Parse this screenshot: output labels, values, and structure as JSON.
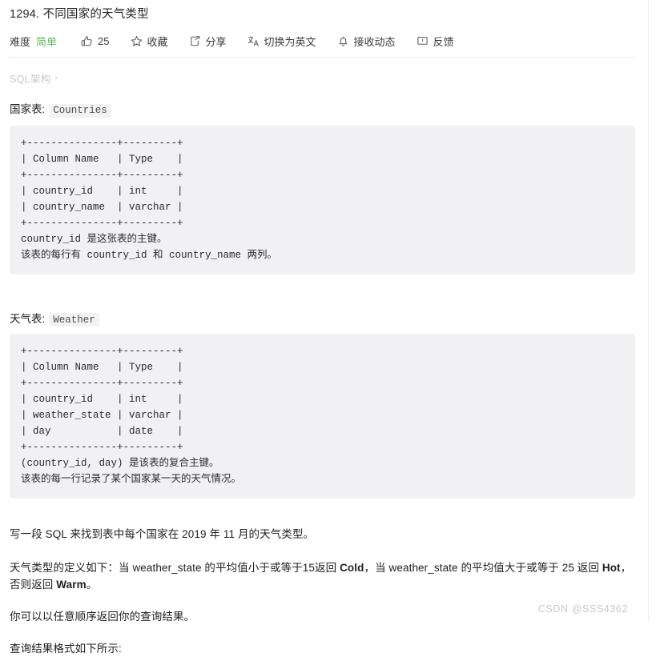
{
  "problem": {
    "title": "1294. 不同国家的天气类型"
  },
  "toolbar": {
    "difficulty_label": "难度",
    "difficulty_value": "简单",
    "like_count": "25",
    "favorite_label": "收藏",
    "share_label": "分享",
    "translate_label": "切换为英文",
    "subscribe_label": "接收动态",
    "feedback_label": "反馈",
    "icons": {
      "like": "thumbs-up-icon",
      "favorite": "star-icon",
      "share": "share-icon",
      "translate": "translate-icon",
      "subscribe": "bell-icon",
      "feedback": "feedback-icon"
    }
  },
  "schema_section": {
    "label": "SQL架构",
    "chevron": "›"
  },
  "tables": [
    {
      "caption": "国家表:",
      "name": "Countries",
      "code": "+---------------+---------+\n| Column Name   | Type    |\n+---------------+---------+\n| country_id    | int     |\n| country_name  | varchar |\n+---------------+---------+\ncountry_id 是这张表的主键。\n该表的每行有 country_id 和 country_name 两列。"
    },
    {
      "caption": "天气表:",
      "name": "Weather",
      "code": "+---------------+---------+\n| Column Name   | Type    |\n+---------------+---------+\n| country_id    | int     |\n| weather_state | varchar |\n| day           | date    |\n+---------------+---------+\n(country_id, day) 是该表的复合主键。\n该表的每一行记录了某个国家某一天的天气情况。"
    }
  ],
  "description": {
    "p1": "写一段 SQL 来找到表中每个国家在 2019 年 11 月的天气类型。",
    "p2_part1": "天气类型的定义如下：当 weather_state 的平均值小于或等于15返回 ",
    "p2_bold1": "Cold",
    "p2_part2": "，当 weather_state 的平均值大于或等于 25 返回 ",
    "p2_bold2": "Hot",
    "p2_part3": "，否则返回 ",
    "p2_bold3": "Warm",
    "p2_part4": "。",
    "p3": "你可以以任意顺序返回你的查询结果。",
    "p4": "查询结果格式如下所示:"
  },
  "watermark": "CSDN @SSS4362"
}
